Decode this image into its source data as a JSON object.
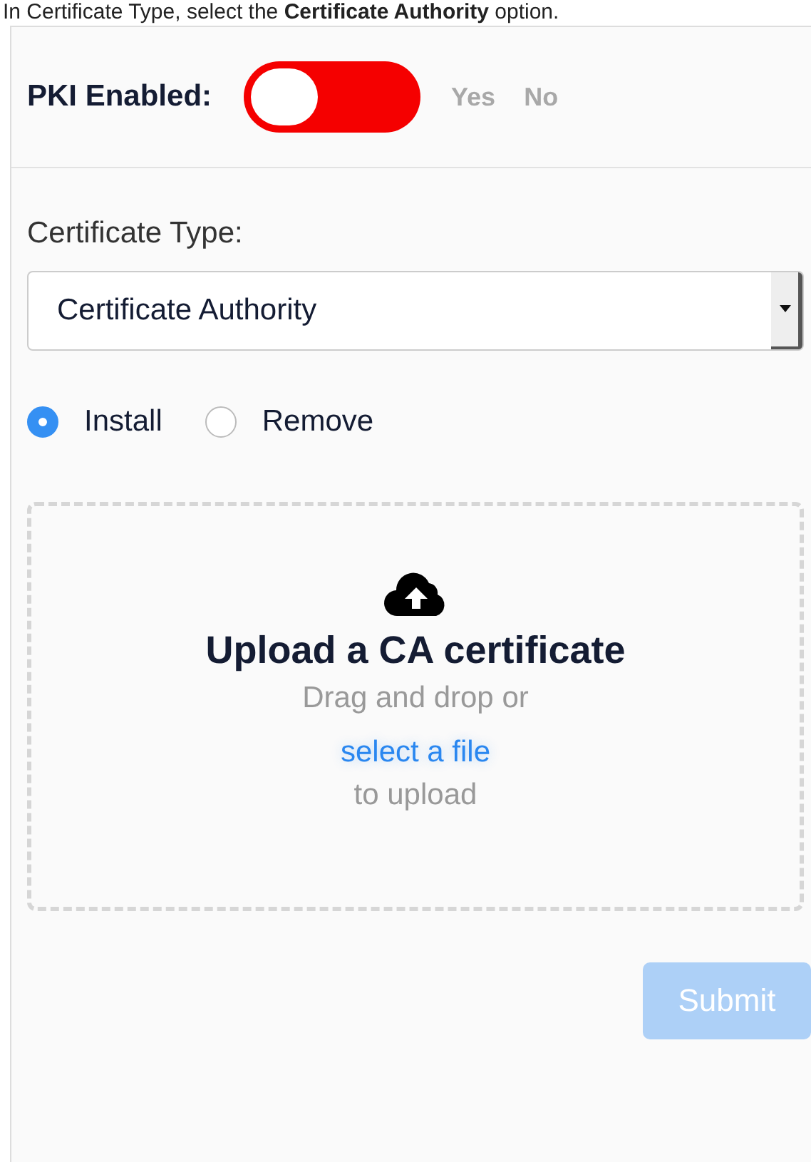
{
  "instruction": "In Certificate Type, select the **Certificate Authority** option.",
  "pki": {
    "label": "PKI Enabled:",
    "on": false,
    "on_label": "Yes",
    "off_label": "No"
  },
  "certificate_type": {
    "label": "Certificate Type:",
    "value": "Certificate Authority"
  },
  "actions": [
    {
      "label": "Install",
      "selected": true
    },
    {
      "label": "Remove",
      "selected": false
    }
  ],
  "upload": {
    "title": "Upload a CA certificate",
    "line_1": "Drag and drop or",
    "link": "select a file",
    "line_2": "to upload"
  },
  "submit": {
    "label": "Submit",
    "disabled": true
  }
}
